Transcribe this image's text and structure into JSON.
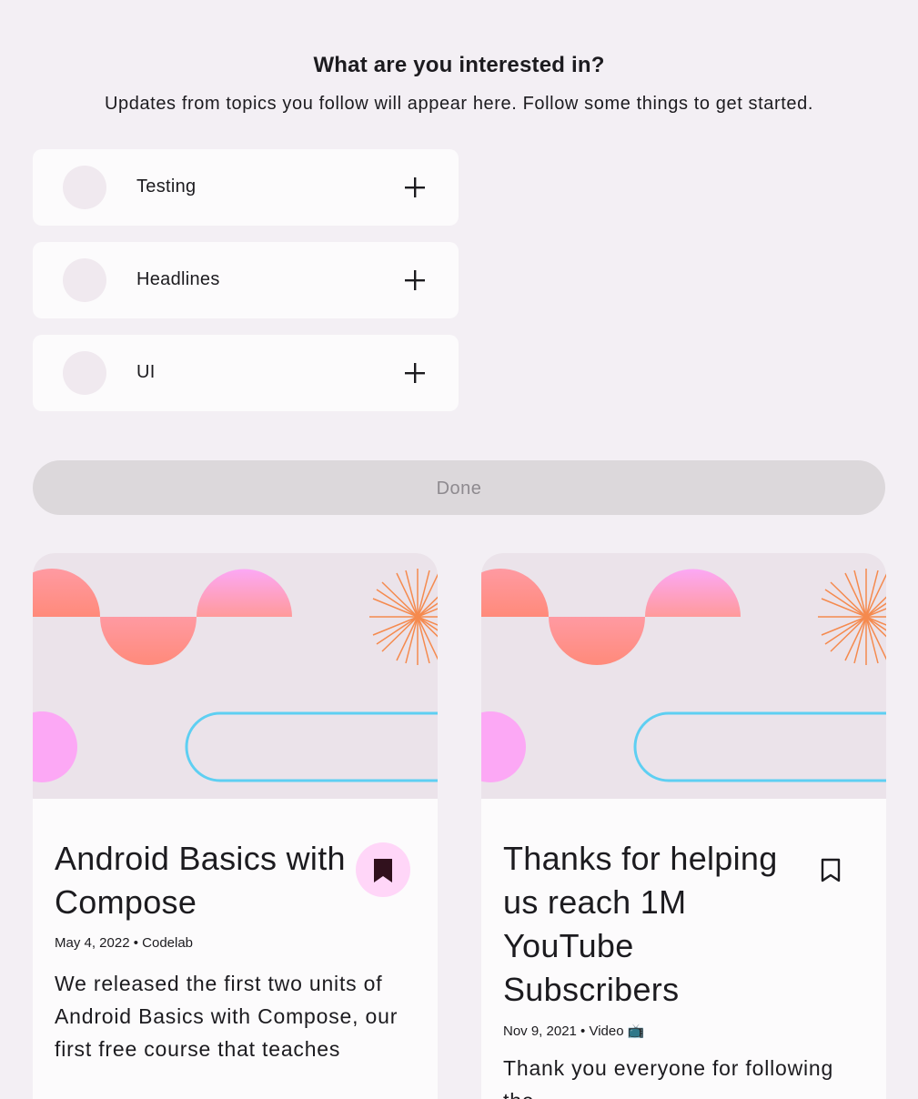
{
  "header": {
    "title": "What are you interested in?",
    "subtitle": "Updates from topics you follow will appear here. Follow some things to get started."
  },
  "topics": [
    {
      "label": "Testing",
      "icon": "plus-icon"
    },
    {
      "label": "Headlines",
      "icon": "plus-icon"
    },
    {
      "label": "UI",
      "icon": "plus-icon"
    }
  ],
  "done_label": "Done",
  "cards": [
    {
      "title": "Android Basics with Compose",
      "meta": "May 4, 2022 • Codelab",
      "description": "We released the first two units of Android Basics with Compose, our first free course that teaches",
      "bookmarked": true,
      "icon": "bookmark-filled-icon"
    },
    {
      "title": "Thanks for helping us reach 1M YouTube Subscribers",
      "meta": "Nov 9, 2021 • Video 📺",
      "description": "Thank you everyone for following the",
      "bookmarked": false,
      "icon": "bookmark-outline-icon"
    }
  ],
  "colors": {
    "background": "#f3eff4",
    "surface": "#fcfbfc",
    "accent_pink": "#ffd6f8",
    "bookmark_dark": "#31111d",
    "art_coral": "#ff8a80",
    "art_pink": "#fca8f5",
    "art_cyan": "#5ecff2",
    "art_orange": "#f58a4e"
  }
}
